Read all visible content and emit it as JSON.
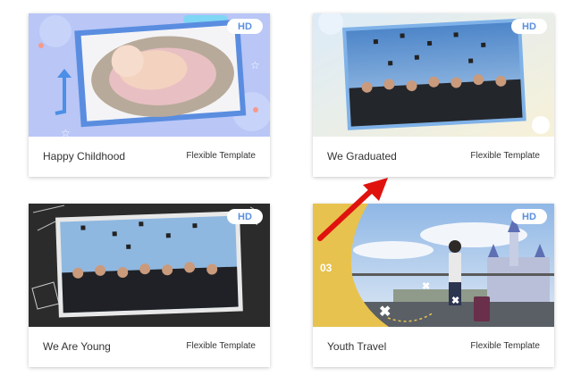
{
  "cards": [
    {
      "title": "Happy Childhood",
      "type": "Flexible Template",
      "badge": "HD"
    },
    {
      "title": "We Graduated",
      "type": "Flexible Template",
      "badge": "HD"
    },
    {
      "title": "We Are Young",
      "type": "Flexible Template",
      "badge": "HD"
    },
    {
      "title": "Youth Travel",
      "type": "Flexible Template",
      "badge": "HD",
      "overlay_number": "03"
    }
  ]
}
